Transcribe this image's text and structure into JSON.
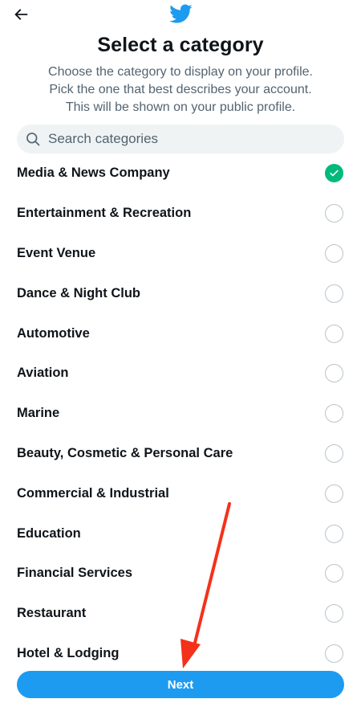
{
  "header": {
    "back_icon": "arrow-left-icon",
    "logo_icon": "twitter-bird-icon",
    "title": "Select a category",
    "subtitle_lines": [
      "Choose the category to display on your profile.",
      "Pick the one that best describes your account.",
      "This will be shown on your public profile."
    ]
  },
  "search": {
    "icon": "search-icon",
    "placeholder": "Search categories",
    "value": ""
  },
  "categories": [
    {
      "label": "Media & News Company",
      "selected": true
    },
    {
      "label": "Entertainment & Recreation",
      "selected": false
    },
    {
      "label": "Event Venue",
      "selected": false
    },
    {
      "label": "Dance & Night Club",
      "selected": false
    },
    {
      "label": "Automotive",
      "selected": false
    },
    {
      "label": "Aviation",
      "selected": false
    },
    {
      "label": "Marine",
      "selected": false
    },
    {
      "label": "Beauty, Cosmetic & Personal Care",
      "selected": false
    },
    {
      "label": "Commercial & Industrial",
      "selected": false
    },
    {
      "label": "Education",
      "selected": false
    },
    {
      "label": "Financial Services",
      "selected": false
    },
    {
      "label": "Restaurant",
      "selected": false
    },
    {
      "label": "Hotel & Lodging",
      "selected": false
    }
  ],
  "footer": {
    "next_label": "Next"
  },
  "colors": {
    "brand": "#1d9bf0",
    "selected": "#00ba7c",
    "annotation_arrow": "#f4311a"
  }
}
